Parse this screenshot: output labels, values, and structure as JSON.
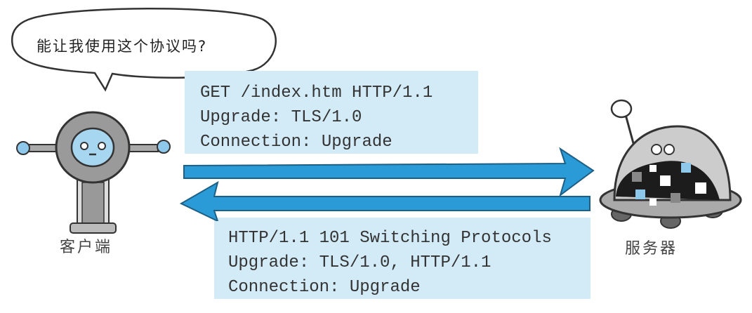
{
  "speech_bubble": {
    "text": "能让我使用这个协议吗?"
  },
  "request": {
    "lines": [
      "GET /index.htm HTTP/1.1",
      "Upgrade: TLS/1.0",
      "Connection: Upgrade"
    ]
  },
  "response": {
    "lines": [
      "HTTP/1.1 101 Switching Protocols",
      "Upgrade: TLS/1.0, HTTP/1.1",
      "Connection: Upgrade"
    ]
  },
  "client": {
    "label": "客户端"
  },
  "server": {
    "label": "服务器"
  },
  "colors": {
    "box": "#d3ebf7",
    "arrow": "#2a9bd6"
  }
}
